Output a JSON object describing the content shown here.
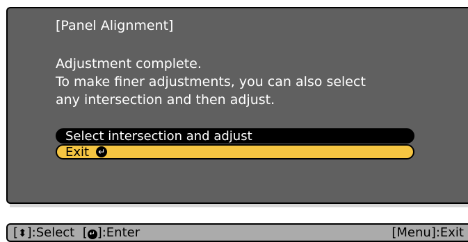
{
  "dialog": {
    "title": "[Panel Alignment]",
    "message_lines": [
      "Adjustment complete.",
      "To make finer adjustments, you can also select",
      "any intersection and then adjust."
    ],
    "menu": [
      {
        "label": "Select intersection and adjust",
        "selected": false
      },
      {
        "label": "Exit",
        "selected": true
      }
    ]
  },
  "help": {
    "select_open": "[",
    "select_icon": "updown-arrow-icon",
    "select_glyph": "⬍",
    "select_close": "]:Select",
    "enter_open": "[",
    "enter_icon": "enter-icon",
    "enter_glyph": "↵",
    "enter_close": "]:Enter",
    "exit": "[Menu]:Exit"
  },
  "colors": {
    "panel_bg": "#606060",
    "highlight": "#f5c542",
    "help_bg": "#ababab",
    "text": "#ffffff"
  }
}
